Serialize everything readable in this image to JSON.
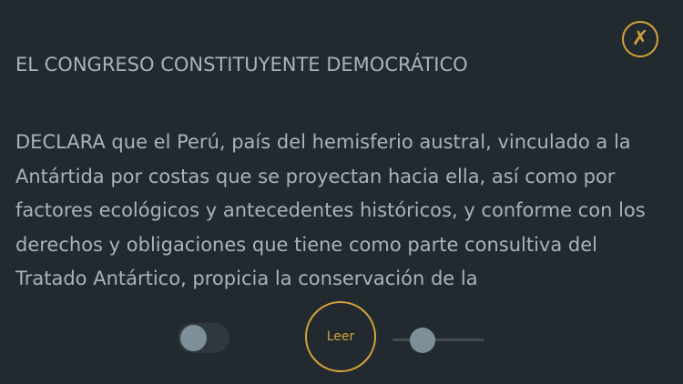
{
  "header": {
    "close_glyph": "✗",
    "title": "EL CONGRESO CONSTITUYENTE DEMOCRÁTICO"
  },
  "content": {
    "text": "DECLARA que el Perú, país del hemisferio austral, vinculado a la Antártida por costas que se proyectan hacia ella, así como por factores ecológicos y antecedentes históricos, y conforme con los derechos y obligaciones que tiene como parte consultiva del Tratado Antártico, propicia la conservación de la"
  },
  "controls": {
    "toggle_on": false,
    "read_label": "Leer",
    "slider_value": 0.33
  },
  "colors": {
    "background": "#222a30",
    "accent": "#d4a43a",
    "text": "#a9b3b8",
    "control_fill": "#7d8f99"
  },
  "icons": {
    "close": "close-icon"
  }
}
